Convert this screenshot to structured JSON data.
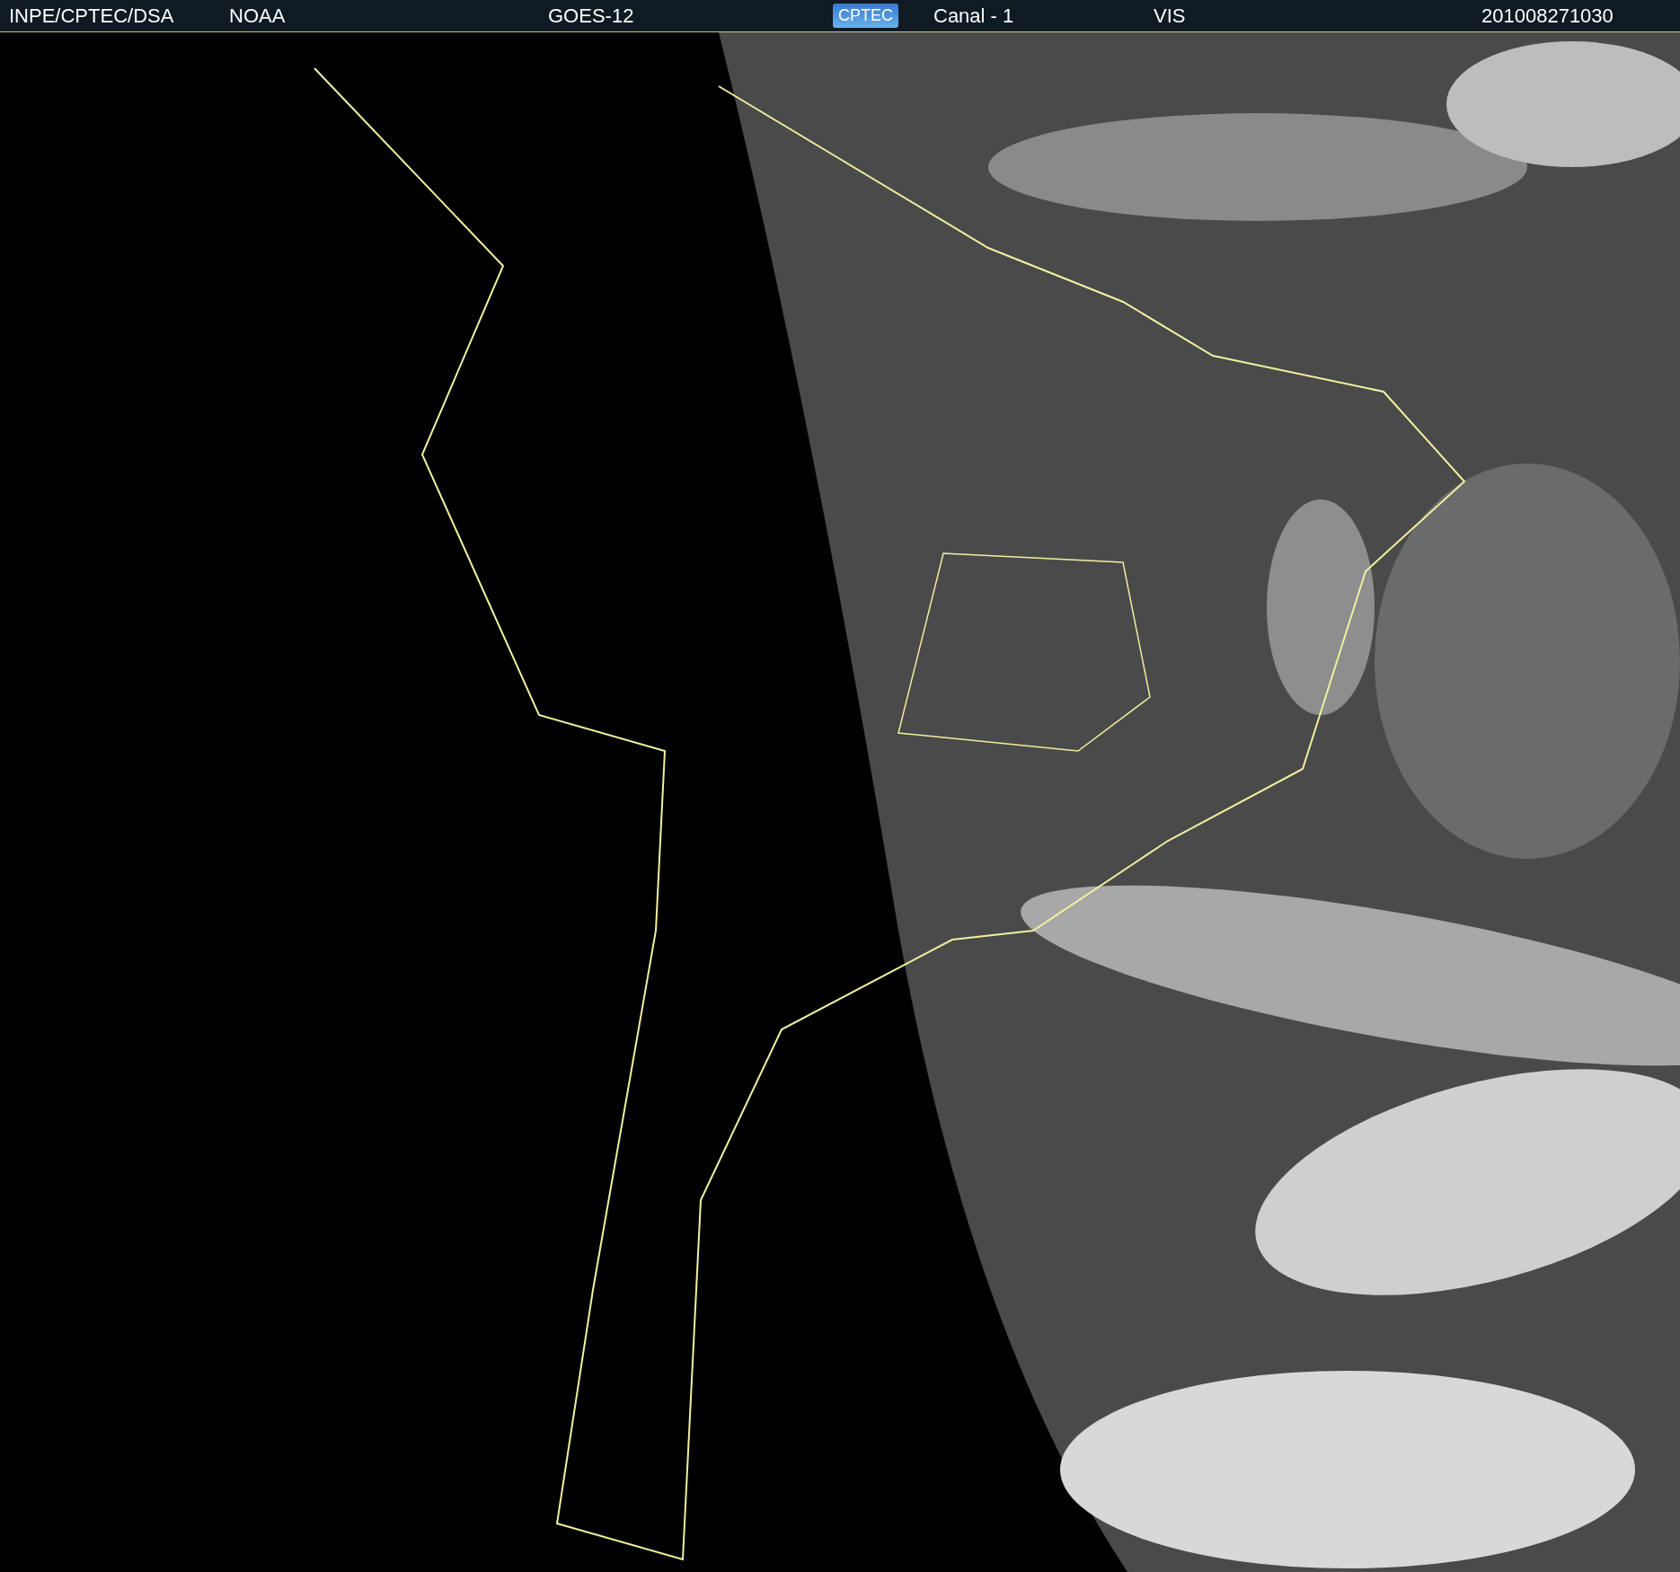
{
  "header": {
    "items": [
      {
        "kind": "text",
        "text": "INPE/CPTEC/DSA"
      },
      {
        "kind": "text",
        "text": "NOAA"
      },
      {
        "kind": "text",
        "text": "GOES-12"
      },
      {
        "kind": "logo",
        "text": "CPTEC"
      },
      {
        "kind": "text",
        "text": "Canal - 1"
      },
      {
        "kind": "text",
        "text": "VIS"
      },
      {
        "kind": "text",
        "text": "201008271030"
      }
    ]
  }
}
